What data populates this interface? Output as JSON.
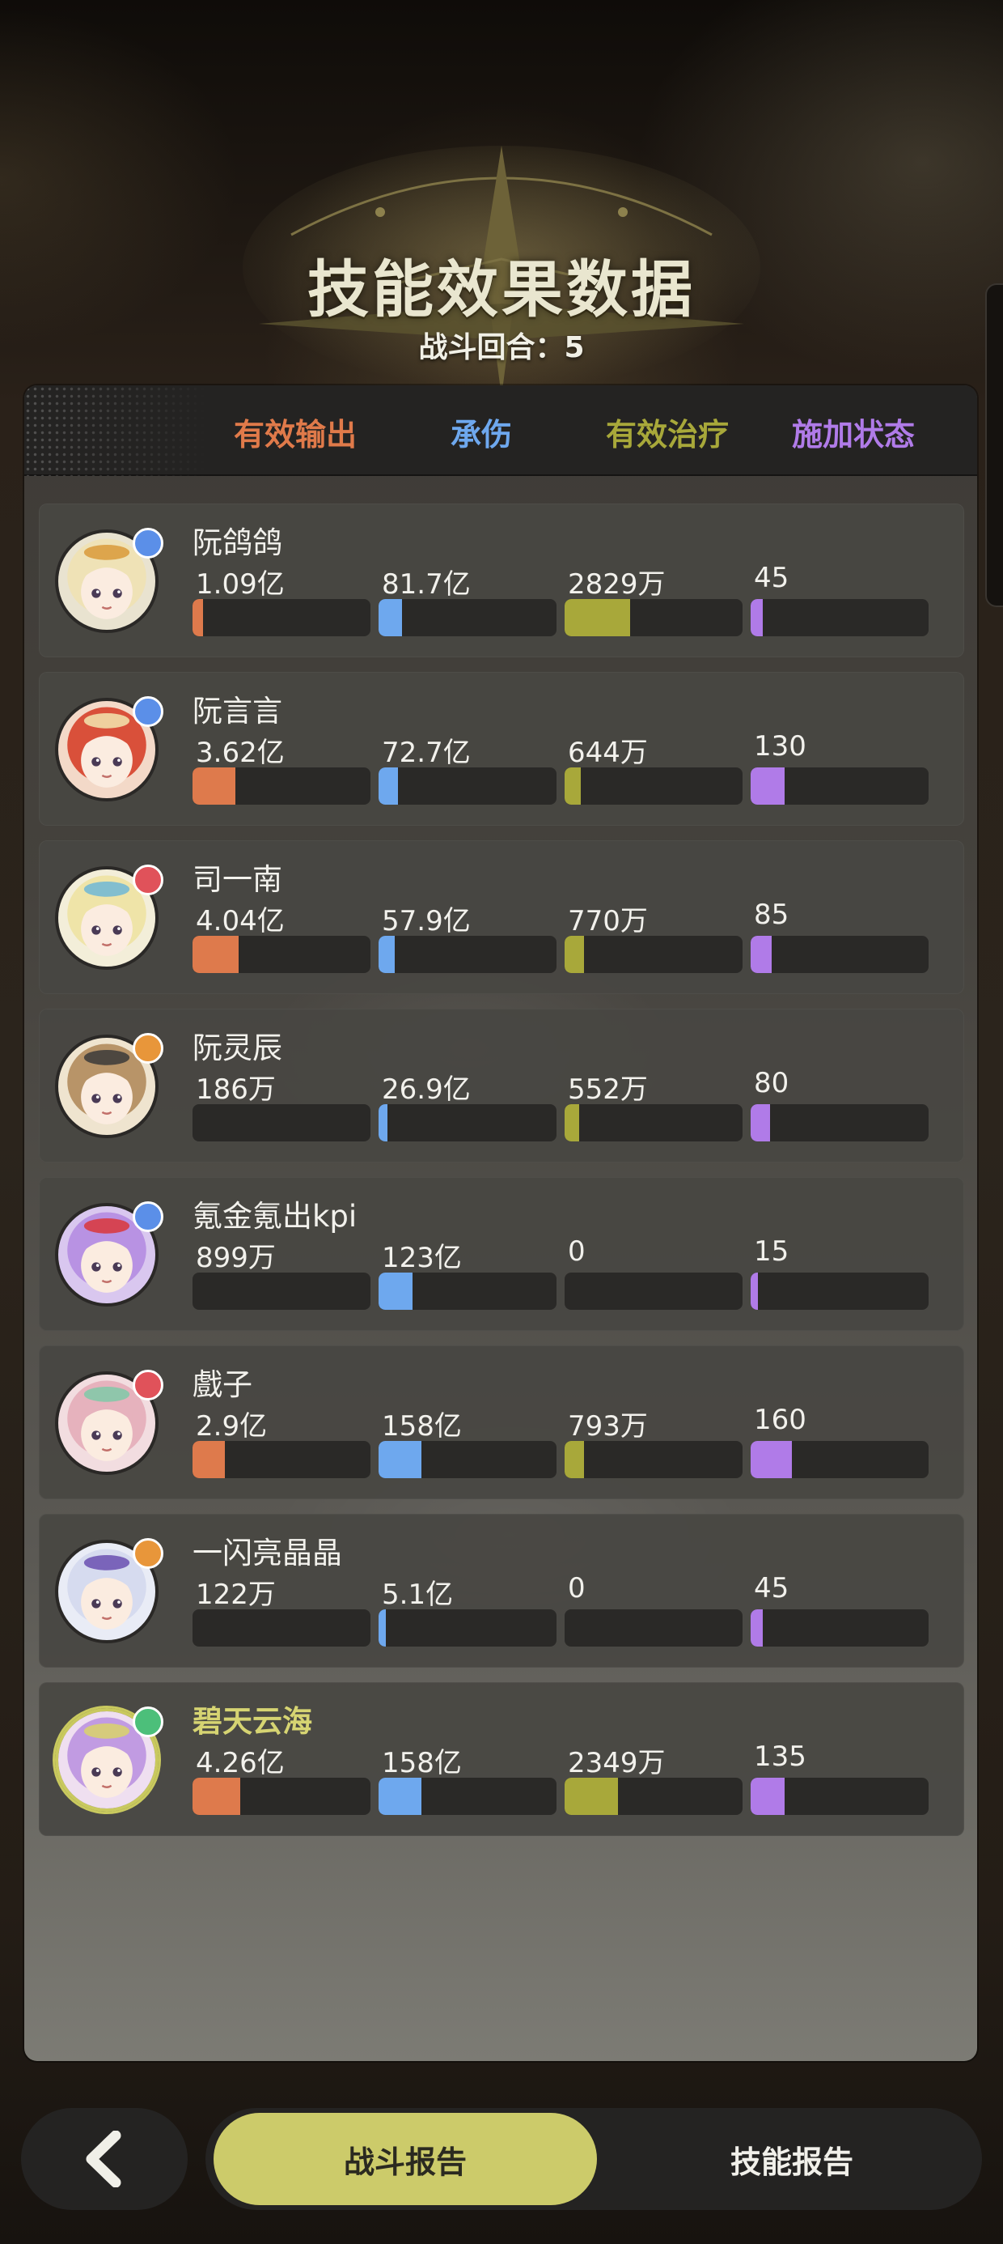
{
  "header": {
    "title": "技能效果数据",
    "rounds": "战斗回合：5"
  },
  "columns": [
    {
      "label": "有效输出",
      "color": "#e07a4a"
    },
    {
      "label": "承伤",
      "color": "#6ea8ee"
    },
    {
      "label": "有效治疗",
      "color": "#a8a83a"
    },
    {
      "label": "施加状态",
      "color": "#b07be8"
    }
  ],
  "bar_colors": [
    "#de7a4c",
    "#6ea8ee",
    "#a8a83a",
    "#b07be8"
  ],
  "players": [
    {
      "name": "阮鸽鸽",
      "badge_color": "#5b8fe8",
      "avatar": "blonde-hat",
      "values": [
        "1.09亿",
        "81.7亿",
        "2829万",
        "45"
      ],
      "fractions": [
        0.06,
        0.13,
        0.37,
        0.07
      ]
    },
    {
      "name": "阮言言",
      "badge_color": "#5b8fe8",
      "avatar": "red-hair",
      "values": [
        "3.62亿",
        "72.7亿",
        "644万",
        "130"
      ],
      "fractions": [
        0.24,
        0.11,
        0.09,
        0.19
      ]
    },
    {
      "name": "司一南",
      "badge_color": "#e0525a",
      "avatar": "blonde-glasses",
      "values": [
        "4.04亿",
        "57.9亿",
        "770万",
        "85"
      ],
      "fractions": [
        0.26,
        0.09,
        0.11,
        0.12
      ]
    },
    {
      "name": "阮灵辰",
      "badge_color": "#e8963a",
      "avatar": "sunglasses",
      "values": [
        "186万",
        "26.9亿",
        "552万",
        "80"
      ],
      "fractions": [
        0.0,
        0.05,
        0.08,
        0.11
      ]
    },
    {
      "name": "氪金氪出kpi",
      "badge_color": "#5b8fe8",
      "avatar": "purple-goggles",
      "values": [
        "899万",
        "123亿",
        "0",
        "15"
      ],
      "fractions": [
        0.0,
        0.19,
        0.0,
        0.03
      ]
    },
    {
      "name": "戲子",
      "badge_color": "#e0525a",
      "avatar": "pink-hair",
      "values": [
        "2.9亿",
        "158亿",
        "793万",
        "160"
      ],
      "fractions": [
        0.18,
        0.24,
        0.11,
        0.23
      ]
    },
    {
      "name": "一闪亮晶晶",
      "badge_color": "#e8963a",
      "avatar": "white-hair",
      "values": [
        "122万",
        "5.1亿",
        "0",
        "45"
      ],
      "fractions": [
        0.0,
        0.01,
        0.0,
        0.07
      ]
    },
    {
      "name": "碧天云海",
      "badge_color": "#4cbf7a",
      "avatar": "purple-flower",
      "values": [
        "4.26亿",
        "158亿",
        "2349万",
        "135"
      ],
      "fractions": [
        0.27,
        0.24,
        0.3,
        0.19
      ],
      "highlighted": true
    }
  ],
  "nav": {
    "back_icon": "chevron-left-icon",
    "tabs": [
      "战斗报告",
      "技能报告"
    ],
    "active_tab": 0
  }
}
